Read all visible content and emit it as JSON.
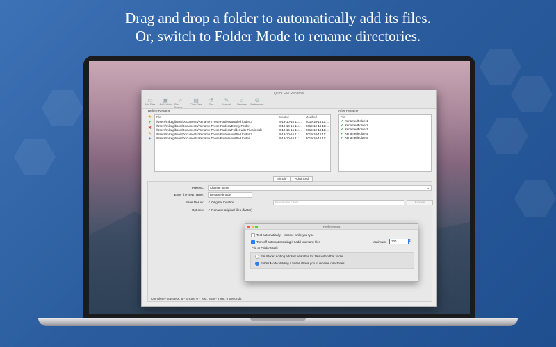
{
  "headline": {
    "line1": "Drag and drop a folder to automatically add its files.",
    "line2": "Or, switch to Folder Mode to rename directories."
  },
  "app": {
    "title": "Quick File Renamer",
    "toolbar": [
      {
        "label": "Add Files",
        "icon": "add-files-icon",
        "glyph": "▭"
      },
      {
        "label": "Add Folder",
        "icon": "add-folder-icon",
        "glyph": "▣"
      },
      {
        "label": "File Search",
        "icon": "search-icon",
        "glyph": "⌕"
      },
      {
        "label": "Clear Files",
        "icon": "clear-icon",
        "glyph": "▤"
      },
      {
        "label": "Test",
        "icon": "test-icon",
        "glyph": "⚗"
      },
      {
        "label": "Manual",
        "icon": "manual-icon",
        "glyph": "✎"
      },
      {
        "label": "Rename",
        "icon": "rename-icon",
        "glyph": "⌂"
      },
      {
        "label": "Preferences",
        "icon": "preferences-icon",
        "glyph": "⚙"
      }
    ],
    "before_label": "Before Rename",
    "after_label": "After Rename",
    "before_columns": [
      "File",
      "Created",
      "Modified"
    ],
    "before_rows": [
      {
        "file": "/Users/mikegibson/Documents/Rename These Folders/untitled folder 3",
        "created": "2019-10-16 11:...",
        "modified": "2019-10-16 11:..."
      },
      {
        "file": "/Users/mikegibson/Documents/Rename These Folders/Empty Folder",
        "created": "2019-10-16 11:...",
        "modified": "2019-10-16 11:..."
      },
      {
        "file": "/Users/mikegibson/Documents/Rename These Folders/Folder with Files inside",
        "created": "2019-10-16 11:...",
        "modified": "2019-10-16 11:..."
      },
      {
        "file": "/Users/mikegibson/Documents/Rename These Folders/untitled folder 2",
        "created": "2019-10-16 11:...",
        "modified": "2019-10-16 11:..."
      },
      {
        "file": "/Users/mikegibson/Documents/Rename These Folders/untitled folder",
        "created": "2019-10-16 11:...",
        "modified": "2019-10-16 11:..."
      }
    ],
    "after_columns": [
      "File"
    ],
    "after_rows": [
      "RenamedFolder1",
      "RenamedFolder2",
      "RenamedFolder3",
      "RenamedFolder4",
      "RenamedFolder5"
    ],
    "side_buttons": [
      {
        "icon": "star-icon",
        "glyph": "★",
        "color": "#e6a100"
      },
      {
        "icon": "add-icon",
        "glyph": "+",
        "color": "#2c9b2c"
      },
      {
        "icon": "remove-icon",
        "glyph": "✖",
        "color": "#d03a2f"
      },
      {
        "icon": "edit-icon",
        "glyph": "✎",
        "color": "#d08a1f"
      },
      {
        "icon": "tag-icon",
        "glyph": "✦",
        "color": "#4f86c6"
      }
    ],
    "tabs": [
      "Simple",
      "Advanced"
    ],
    "form": {
      "presets_label": "Presets:",
      "presets_value": "Change name",
      "new_name_label": "Enter the new name:",
      "new_name_value": "RenamedFolder",
      "save_label": "Save files in:",
      "save_option": "Original location",
      "browse_placeholder": "Browse for folder",
      "browse_button": "Browse",
      "options_label": "Options:",
      "options_value": "Rename original files (faster)"
    },
    "status": "Complete - Success: 5 - Errors: 0 - Test: True - Time: 0 Seconds"
  },
  "preferences": {
    "title": "Preferences",
    "test_auto": "Test automatically - rename while you type",
    "turn_off": "Turn off automatic testing if I add too many files",
    "maximum_label": "Maximum:",
    "maximum_value": "100",
    "group_label": "File or Folder Mode",
    "file_mode": "File Mode: Adding a folder searches for files within that folder",
    "folder_mode": "Folder Mode: Adding a folder allows you to rename directories"
  },
  "colors": {
    "accent": "#2f7bf0",
    "success": "#2c9b2c",
    "background": "#2b5d9e"
  }
}
